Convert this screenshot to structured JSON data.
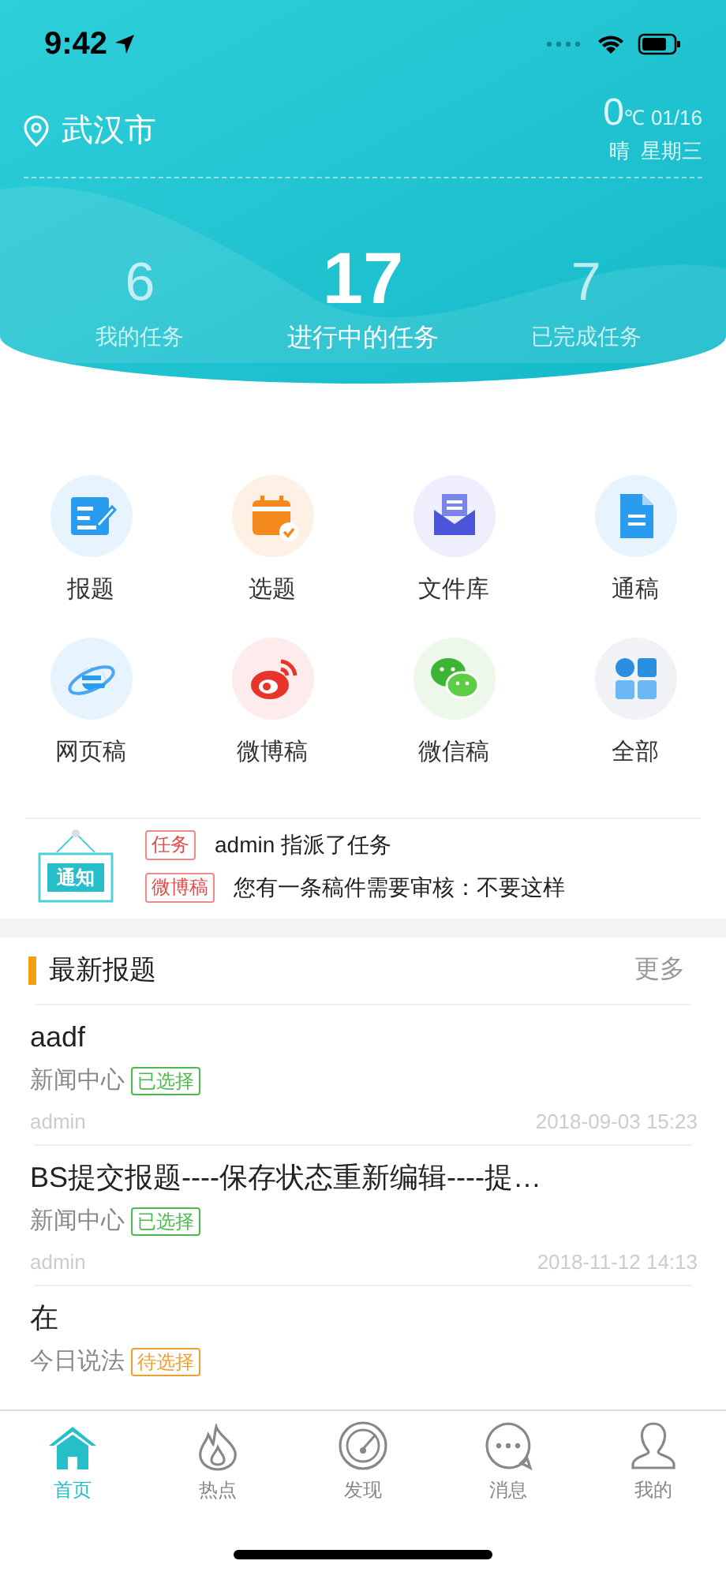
{
  "status_bar": {
    "time": "9:42"
  },
  "header": {
    "city": "武汉市",
    "temperature": "0",
    "unit": "℃",
    "date": "01/16",
    "weather": "晴  星期三"
  },
  "stats": [
    {
      "value": "6",
      "label": "我的任务",
      "selected": false
    },
    {
      "value": "17",
      "label": "进行中的任务",
      "selected": true
    },
    {
      "value": "7",
      "label": "已完成任务",
      "selected": false
    }
  ],
  "shortcuts": [
    {
      "label": "报题"
    },
    {
      "label": "选题"
    },
    {
      "label": "文件库"
    },
    {
      "label": "通稿"
    },
    {
      "label": "网页稿"
    },
    {
      "label": "微博稿"
    },
    {
      "label": "微信稿"
    },
    {
      "label": "全部"
    }
  ],
  "notice": {
    "badge": "通知",
    "items": [
      {
        "tag": "任务",
        "text": "admin 指派了任务"
      },
      {
        "tag": "微博稿",
        "text": "您有一条稿件需要审核：不要这样"
      }
    ]
  },
  "section": {
    "title": "最新报题",
    "more": "更多"
  },
  "posts": [
    {
      "title": "aadf",
      "category": "新闻中心",
      "status": "已选择",
      "color": "#4cba4c",
      "author": "admin",
      "time": "2018-09-03 15:23"
    },
    {
      "title": "BS提交报题----保存状态重新编辑----提…",
      "category": "新闻中心",
      "status": "已选择",
      "color": "#4cba4c",
      "author": "admin",
      "time": "2018-11-12 14:13"
    },
    {
      "title": "在",
      "category": "今日说法",
      "status": "待选择",
      "color": "#f0a030"
    }
  ],
  "tab_bar": [
    {
      "label": "首页",
      "selected": true
    },
    {
      "label": "热点",
      "selected": false
    },
    {
      "label": "发现",
      "selected": false
    },
    {
      "label": "消息",
      "selected": false
    },
    {
      "label": "我的",
      "selected": false
    }
  ]
}
